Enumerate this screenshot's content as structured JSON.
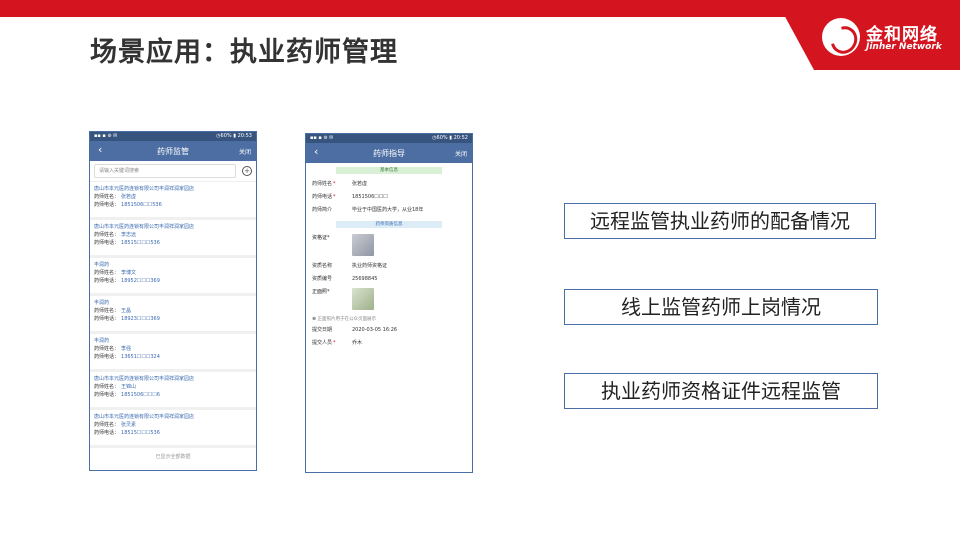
{
  "header": {
    "title": "场景应用：执业药师管理",
    "logo_cn": "金和网络",
    "logo_en": "Jinher Network"
  },
  "phone1": {
    "status_left": "▪▪ ▪ ⊚ ✉",
    "status_right": "◷60% ▮ 20:53",
    "nav_back": "‹",
    "nav_title": "药师监管",
    "nav_close": "关闭",
    "search_placeholder": "请输入关键词搜索",
    "add_icon": "+",
    "name_label": "药师姓名：",
    "phone_label": "药师电话：",
    "cards": [
      {
        "shop": "唐山市本元医药连锁有限公司丰润祥润家园店",
        "name": "张若虚",
        "phone": "1851506☐☐536"
      },
      {
        "shop": "唐山市本元医药连锁有限公司丰润祥润家园店",
        "name": "李志远",
        "phone": "18515☐☐☐536"
      },
      {
        "shop": "丰润药",
        "name": "李博文",
        "phone": "18952☐☐☐369"
      },
      {
        "shop": "丰润药",
        "name": "王晶",
        "phone": "18923☐☐☐369"
      },
      {
        "shop": "丰润药",
        "name": "李强",
        "phone": "13651☐☐☐324"
      },
      {
        "shop": "唐山市本元医药连锁有限公司丰润祥润家园店",
        "name": "王锦山",
        "phone": "1851506☐☐☐6"
      },
      {
        "shop": "唐山市本元医药连锁有限公司丰润祥润家园店",
        "name": "张灵素",
        "phone": "18515☐☐☐536"
      }
    ],
    "footer": "已显示全部数据"
  },
  "phone2": {
    "status_left": "▪▪ ▪ ⊚ ✉",
    "status_right": "◷60% ▮ 20:52",
    "nav_back": "‹",
    "nav_title": "药师指导",
    "nav_close": "关闭",
    "section_basic": "基本信息",
    "section_cert": "药师资质信息",
    "name_label": "药师姓名",
    "name_value": "张若虚",
    "phone_label": "药师电话",
    "phone_value": "1851506☐☐☐",
    "intro_label": "药师简介",
    "intro_value": "毕业于中国医药大学，从业18年",
    "cert_label": "资格证",
    "cert_name_label": "资质名称",
    "cert_name_value": "执业药师资格证",
    "cert_no_label": "资质编号",
    "cert_no_value": "25698845",
    "photo_label": "正面照",
    "hint": "❶ 正面照片用于在公众页面展示",
    "date_label": "提交日期",
    "date_value": "2020-03-05 16:26",
    "submitter_label": "提交人员",
    "submitter_value": "乔木",
    "required_mark": "*"
  },
  "callouts": [
    "远程监管执业药师的配备情况",
    "线上监管药师上岗情况",
    "执业药师资格证件远程监管"
  ],
  "colors": {
    "brand_red": "#d4151f",
    "nav_blue": "#4d6ea3",
    "link_blue": "#3a6ab0"
  }
}
